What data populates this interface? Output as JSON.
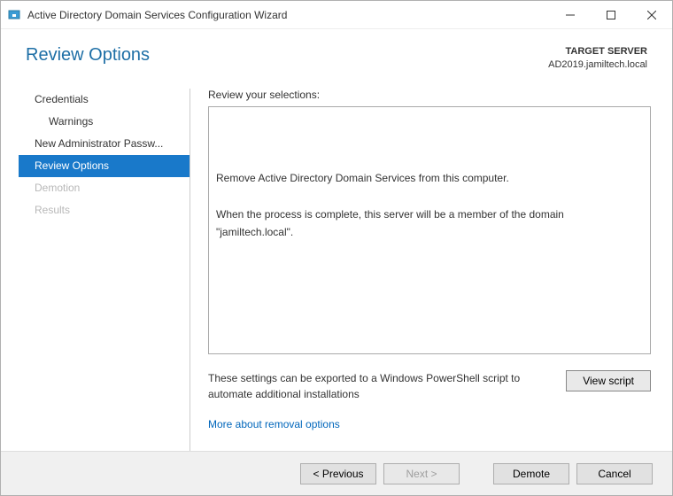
{
  "window": {
    "title": "Active Directory Domain Services Configuration Wizard"
  },
  "header": {
    "page_title": "Review Options",
    "target_label": "TARGET SERVER",
    "target_server": "AD2019.jamiltech.local"
  },
  "sidebar": {
    "items": [
      {
        "label": "Credentials",
        "active": false,
        "disabled": false,
        "sub": false
      },
      {
        "label": "Warnings",
        "active": false,
        "disabled": false,
        "sub": true
      },
      {
        "label": "New Administrator Passw...",
        "active": false,
        "disabled": false,
        "sub": false
      },
      {
        "label": "Review Options",
        "active": true,
        "disabled": false,
        "sub": false
      },
      {
        "label": "Demotion",
        "active": false,
        "disabled": true,
        "sub": false
      },
      {
        "label": "Results",
        "active": false,
        "disabled": true,
        "sub": false
      }
    ]
  },
  "main": {
    "review_label": "Review your selections:",
    "review_line1": "Remove Active Directory Domain Services from this computer.",
    "review_line2": "When the process is complete, this server will be a member of the domain \"jamiltech.local\".",
    "export_text": "These settings can be exported to a Windows PowerShell script to automate additional installations",
    "view_script": "View script",
    "more_link": "More about removal options"
  },
  "footer": {
    "previous": "< Previous",
    "next": "Next >",
    "demote": "Demote",
    "cancel": "Cancel"
  }
}
